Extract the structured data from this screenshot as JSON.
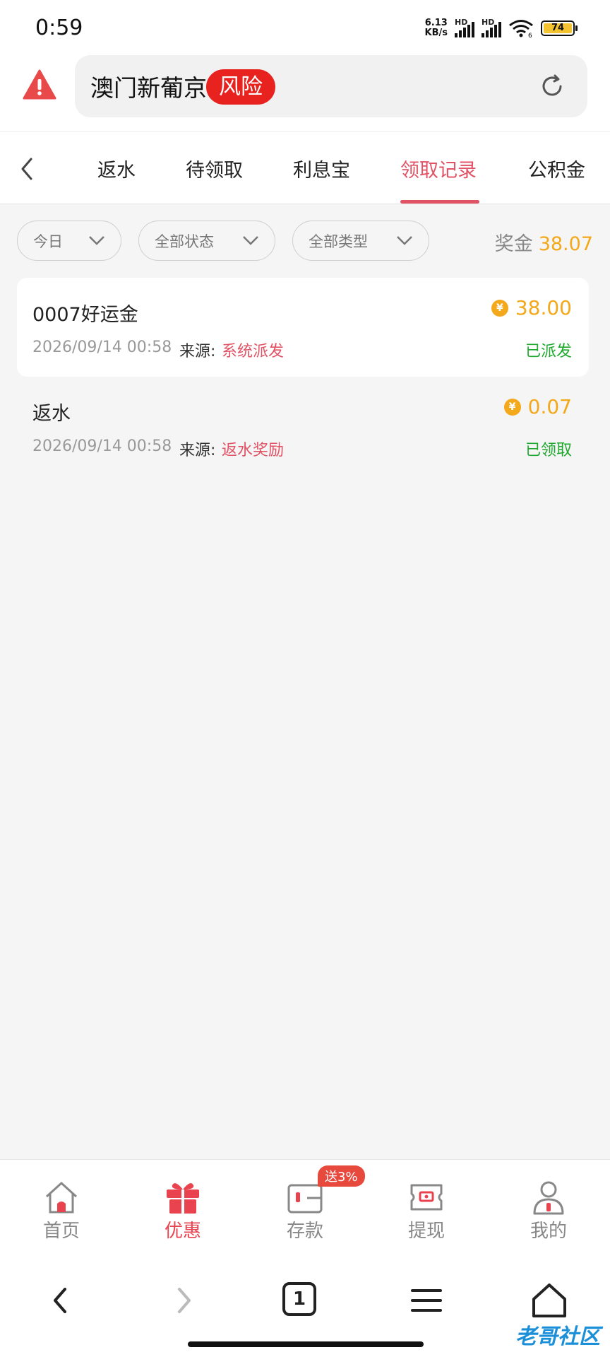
{
  "status_bar": {
    "time": "0:59",
    "speed": "6.13",
    "speed_unit": "KB/s",
    "sim1_label": "HD",
    "sim2_label": "HD",
    "wifi_label": "6",
    "battery": "74"
  },
  "address_bar": {
    "site_name": "澳门新葡京",
    "risk_badge": "风险"
  },
  "tabs": [
    {
      "label": "返水"
    },
    {
      "label": "待领取"
    },
    {
      "label": "利息宝"
    },
    {
      "label": "领取记录",
      "active": true
    },
    {
      "label": "公积金"
    }
  ],
  "filters": {
    "date": "今日",
    "status": "全部状态",
    "type": "全部类型"
  },
  "bonus": {
    "label": "奖金",
    "value": "38.07"
  },
  "records": [
    {
      "title": "0007好运金",
      "amount": "38.00",
      "time": "2026/09/14 00:58",
      "source_label": "来源:",
      "source": "系统派发",
      "status": "已派发"
    },
    {
      "title": "返水",
      "amount": "0.07",
      "time": "2026/09/14 00:58",
      "source_label": "来源:",
      "source": "返水奖励",
      "status": "已领取"
    }
  ],
  "coin_symbol": "¥",
  "bottom_nav": [
    {
      "label": "首页",
      "icon": "home-icon"
    },
    {
      "label": "优惠",
      "icon": "gift-icon",
      "active": true
    },
    {
      "label": "存款",
      "icon": "wallet-icon",
      "badge": "送3%"
    },
    {
      "label": "提现",
      "icon": "ticket-icon"
    },
    {
      "label": "我的",
      "icon": "person-icon"
    }
  ],
  "browser": {
    "tab_count": "1"
  },
  "watermark": "老哥社区",
  "colors": {
    "accent": "#e05264",
    "amount": "#f3a81a",
    "success": "#1ea82e",
    "risk": "#e8221e"
  }
}
